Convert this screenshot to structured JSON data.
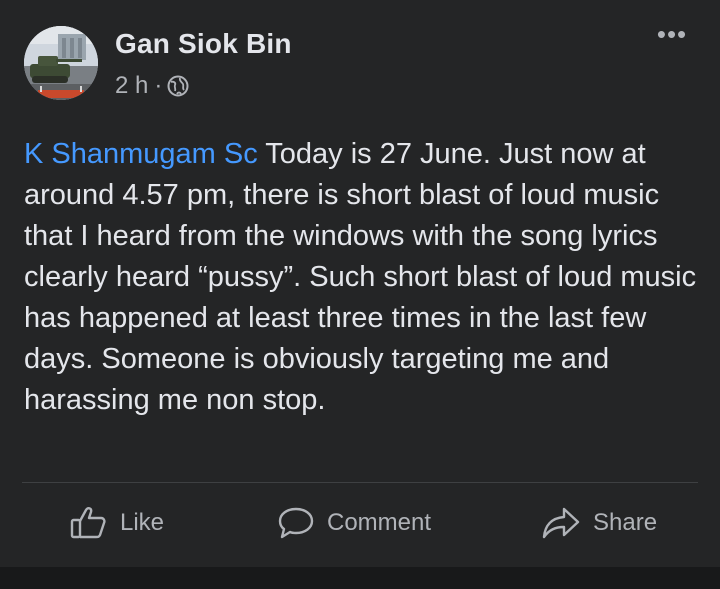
{
  "post": {
    "author": "Gan Siok Bin",
    "time": "2 h",
    "separator": "·",
    "privacy_icon": "globe-icon",
    "more_label": "•••",
    "mention": "K Shanmugam Sc",
    "text": " Today is 27 June. Just now at around 4.57 pm, there is short blast of loud music that I heard from the windows with the song lyrics clearly heard “pussy”.  Such short blast of loud music has happened at least three times in the last few days. Someone is obviously targeting me and harassing me non stop."
  },
  "actions": {
    "like_label": "Like",
    "comment_label": "Comment",
    "share_label": "Share"
  },
  "colors": {
    "background": "#242526",
    "text": "#e4e6eb",
    "secondary_text": "#b0b3b8",
    "mention": "#4599ff",
    "divider": "#3e4042"
  }
}
